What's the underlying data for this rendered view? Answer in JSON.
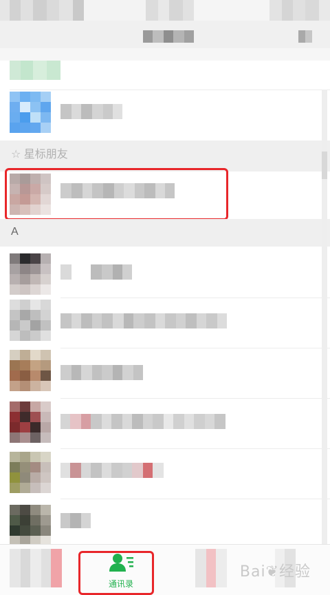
{
  "sections": {
    "starred_header": "☆ 星标朋友",
    "a_header": "A"
  },
  "tabbar": {
    "contacts_label": "通讯录"
  },
  "watermark": {
    "text": "Bai❦经验"
  },
  "colors": {
    "accent_green": "#21b14e",
    "highlight_red": "#e8262a"
  }
}
